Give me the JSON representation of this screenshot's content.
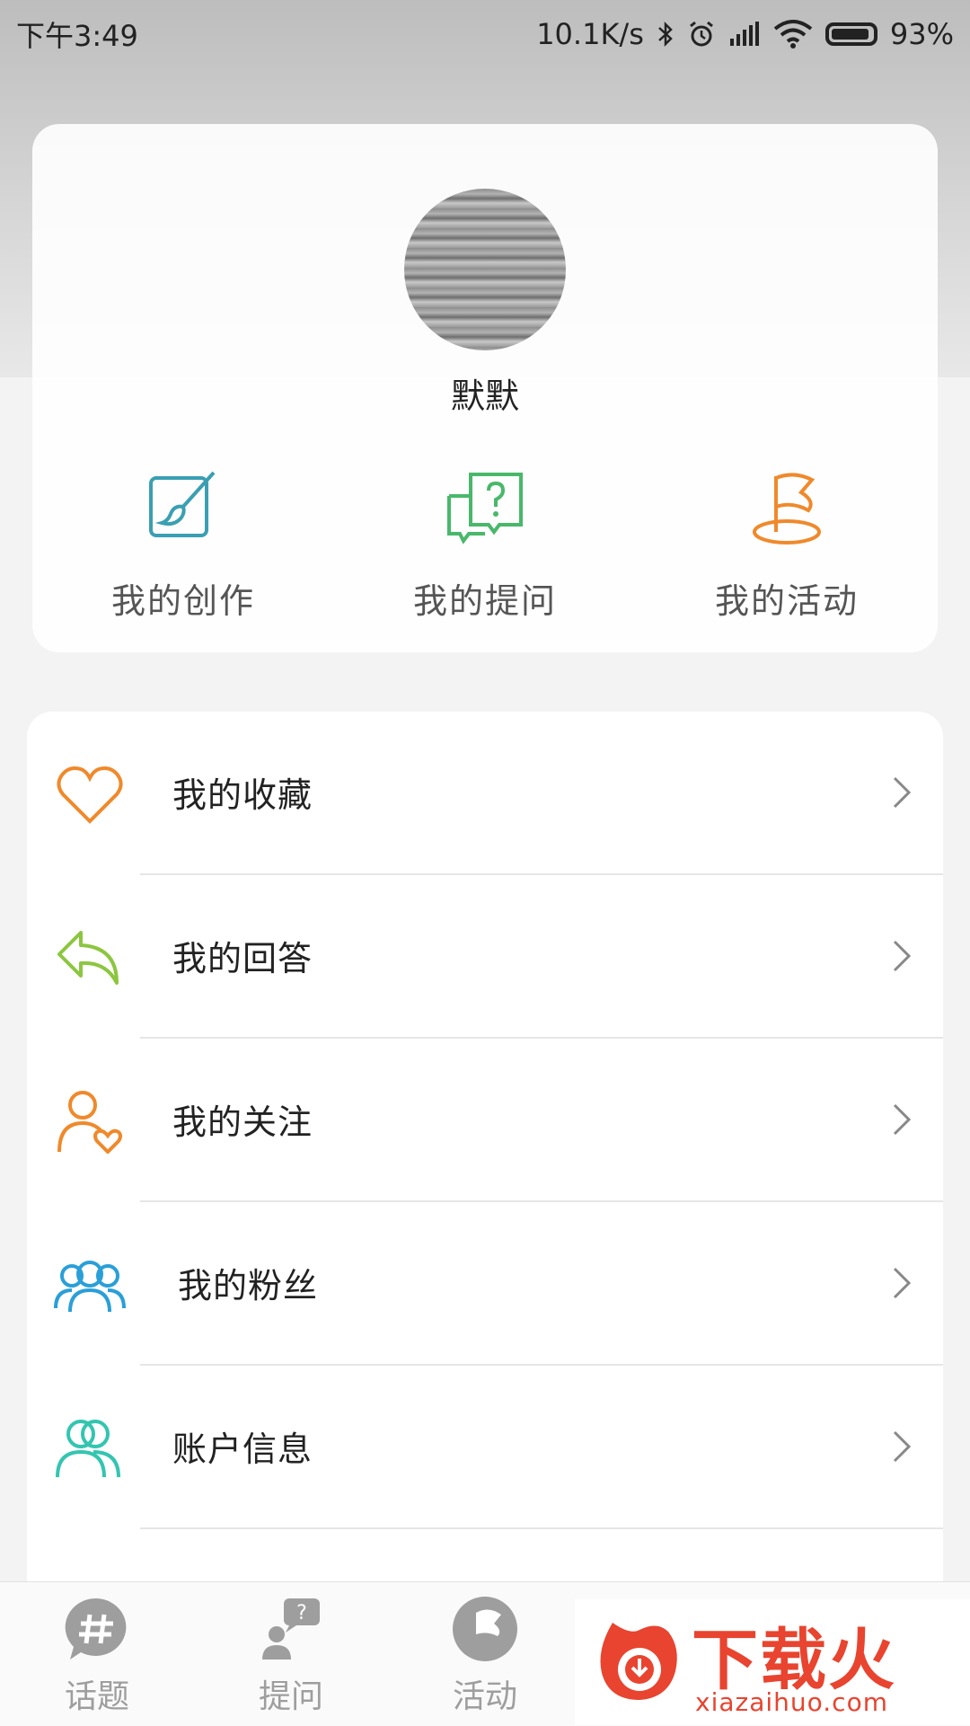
{
  "status_bar": {
    "time": "下午3:49",
    "network_speed": "10.1K/s",
    "battery": "93%",
    "battery_level": 0.93
  },
  "profile": {
    "username": "默默",
    "quick_actions": [
      {
        "label": "我的创作",
        "icon": "brush-canvas-icon",
        "color": "#3a9fb3"
      },
      {
        "label": "我的提问",
        "icon": "question-bubbles-icon",
        "color": "#49b86a"
      },
      {
        "label": "我的活动",
        "icon": "flag-icon",
        "color": "#f0892b"
      }
    ]
  },
  "menu": [
    {
      "label": "我的收藏",
      "icon": "heart-icon",
      "color": "#f0892b"
    },
    {
      "label": "我的回答",
      "icon": "reply-arrow-icon",
      "color": "#8cc63f"
    },
    {
      "label": "我的关注",
      "icon": "user-heart-icon",
      "color": "#f0892b"
    },
    {
      "label": "我的粉丝",
      "icon": "users-icon",
      "color": "#2a9fd8"
    },
    {
      "label": "账户信息",
      "icon": "account-icon",
      "color": "#33c5b0"
    }
  ],
  "tabbar": [
    {
      "label": "话题",
      "icon": "hashtag-bubble-icon"
    },
    {
      "label": "提问",
      "icon": "ask-person-icon"
    },
    {
      "label": "活动",
      "icon": "flag-circle-icon"
    }
  ],
  "watermark": {
    "title": "下载火",
    "url": "xiazaihuo.com",
    "color": "#e8442f"
  }
}
